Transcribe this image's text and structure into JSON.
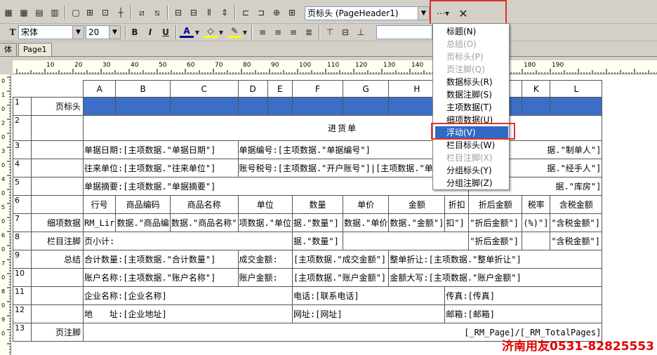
{
  "toolbar1": {
    "band_combo": "页标头 (PageHeader1)",
    "close_symbol": "✕"
  },
  "toolbar2": {
    "font_name": "宋体",
    "font_size": "20",
    "bold": "B",
    "italic": "I",
    "underline": "U",
    "font_color": "A"
  },
  "tabs": [
    {
      "label": "体"
    },
    {
      "label": "Page1"
    }
  ],
  "ruler_labels": [
    "10",
    "20",
    "30",
    "40",
    "50",
    "60",
    "70",
    "80",
    "90",
    "100",
    "110",
    "120",
    "130",
    "140",
    "150",
    "160",
    "170",
    "180",
    "190"
  ],
  "vruler_labels": [
    "0",
    "1",
    "0",
    "2",
    "0",
    "3",
    "0",
    "4",
    "0",
    "5",
    "0",
    "6",
    "0",
    "7",
    "0",
    "8",
    "0",
    "9",
    "0"
  ],
  "grid": {
    "col_headers": [
      "A",
      "B",
      "C",
      "D",
      "E",
      "F",
      "G",
      "H",
      "I",
      "J",
      "K",
      "L"
    ],
    "rows": [
      {
        "n": "1",
        "band": "页标头"
      },
      {
        "n": "2",
        "band": "",
        "title": "进货单"
      },
      {
        "n": "3",
        "band": "",
        "c1": "单据日期:[主项数据.\"单据日期\"]",
        "c2": "单据编号:[主项数据.\"单据编号\"]",
        "c3": "据.\"制单人\"]"
      },
      {
        "n": "4",
        "band": "",
        "c1": "往来单位:[主项数据.\"往来单位\"]",
        "c2": "账号税号:[主项数据.\"开户账号\"]|[主项数据.\"单",
        "c3": "据.\"经手人\"]"
      },
      {
        "n": "5",
        "band": "",
        "c1": "单据摘要:[主项数据.\"单据摘要\"]",
        "c3": "据.\"库房\"]"
      },
      {
        "n": "6",
        "band": "",
        "headers": [
          "行号",
          "商品编码",
          "商品名称",
          "单位",
          "数量",
          "单价",
          "金额",
          "折扣",
          "折后金额",
          "税率",
          "含税金额"
        ]
      },
      {
        "n": "7",
        "band": "细项数据",
        "cells": [
          "RM_Lir",
          "数据.\"商品编",
          "数据.\"商品名称\"",
          "项数据.\"单位",
          "据.\"数量\"]",
          "数据.\"单价",
          "数据.\"金额\"]",
          "扣\"]",
          "\"折后金额\"]",
          "(%)\"]",
          "\"含税金额\"]"
        ]
      },
      {
        "n": "8",
        "band": "栏目注脚",
        "c1": "页小计:",
        "qty": "据.\"数量\"]",
        "dis": "\"折后金额\"]",
        "tax": "\"含税金额\"]"
      },
      {
        "n": "9",
        "band": "总结",
        "c1": "合计数量:[主项数据.\"合计数量\"]",
        "c2": "成交金额:",
        "c3": "[主项数据.\"成交金额\"]",
        "c4": "整单折让:[主项数据.\"整单折让\"]"
      },
      {
        "n": "10",
        "band": "",
        "c1": "账户名称:[主项数据.\"账户名称\"]",
        "c2": "账户金额:",
        "c3": "[主项数据.\"账户金额\"]",
        "c4": "金额大写:[主项数据.\"账户金额\"]"
      },
      {
        "n": "11",
        "band": "",
        "c1": "企业名称:[企业名称]",
        "c2": "电话:[联系电话]",
        "c3": "传真:[传真]"
      },
      {
        "n": "12",
        "band": "",
        "c1": "地　　址:[企业地址]",
        "c2": "网址:[网址]",
        "c3": "邮箱:[邮箱]"
      },
      {
        "n": "13",
        "band": "页注脚",
        "c1": "[_RM_Page]/[_RM_TotalPages]"
      }
    ]
  },
  "menu": {
    "items": [
      {
        "label": "标题(N)",
        "state": "enabled"
      },
      {
        "label": "总结(O)",
        "state": "disabled"
      },
      {
        "label": "页标头(P)",
        "state": "disabled"
      },
      {
        "label": "页注脚(Q)",
        "state": "disabled"
      },
      {
        "label": "数据标头(R)",
        "state": "enabled"
      },
      {
        "label": "数据注脚(S)",
        "state": "enabled"
      },
      {
        "label": "主项数据(T)",
        "state": "enabled"
      },
      {
        "label": "细项数据(U)",
        "state": "enabled"
      },
      {
        "label": "浮动(V)",
        "state": "selected"
      },
      {
        "label": "栏目标头(W)",
        "state": "enabled"
      },
      {
        "label": "栏目注脚(X)",
        "state": "disabled"
      },
      {
        "label": "分组标头(Y)",
        "state": "enabled"
      },
      {
        "label": "分组注脚(Z)",
        "state": "enabled"
      }
    ]
  },
  "watermark": "济南用友0531-82825553",
  "colors": {
    "band_blue": "#3c6ec8",
    "highlight": "#316ac5",
    "red_box": "#e03030"
  }
}
